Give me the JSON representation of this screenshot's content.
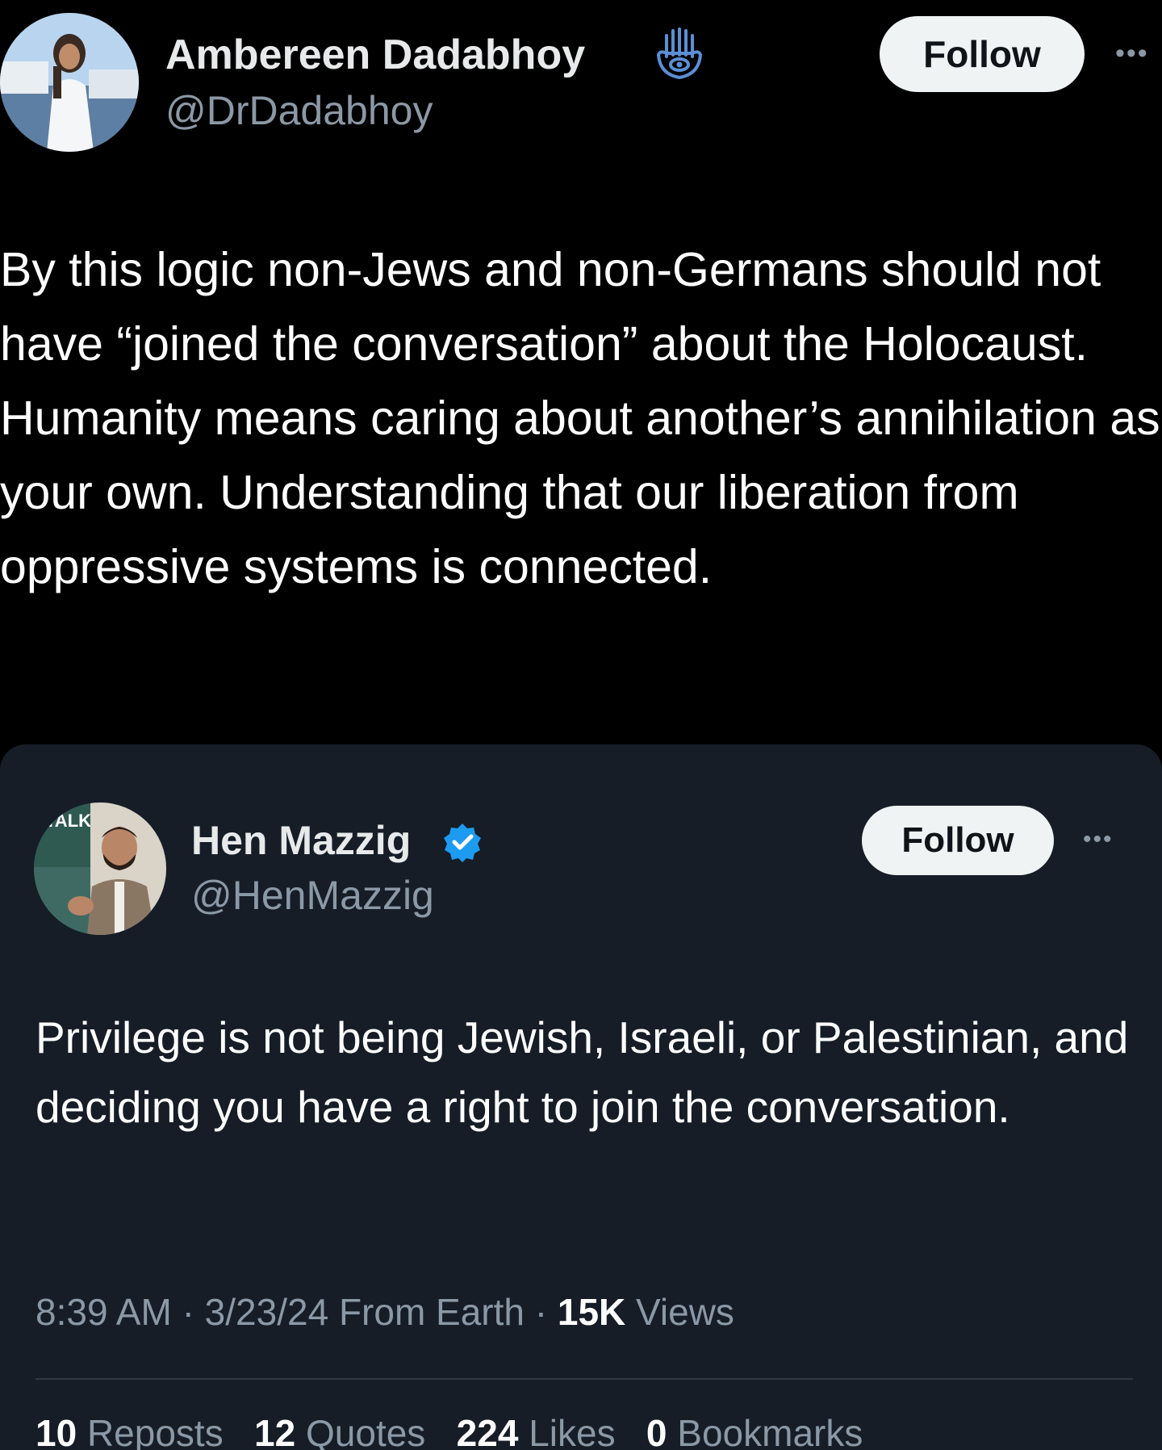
{
  "outer_tweet": {
    "author_name": "Ambereen Dadabhoy",
    "author_handle": "@DrDadabhoy",
    "follow_label": "Follow",
    "more_label": "•••",
    "badge_icon": "hamsa-icon",
    "text": "By this logic non-Jews and non-Germans should not have “joined the conversation” about the Holocaust. Humanity means caring about another’s annihilation as your own. Understanding that our liberation from oppressive systems is connected."
  },
  "quoted_tweet": {
    "author_name": "Hen Mazzig",
    "author_handle": "@HenMazzig",
    "follow_label": "Follow",
    "more_label": "•••",
    "badge_icon": "verified-icon",
    "avatar_sign_text": "TALK JUSTICE",
    "text": "Privilege is not being Jewish, Israeli, or Palestinian, and deciding you have a right to join the conversation.",
    "time": "8:39 AM",
    "date": "3/23/24",
    "location": "From Earth",
    "views_count": "15K",
    "views_label": "Views",
    "stats": {
      "reposts_count": "10",
      "reposts_label": "Reposts",
      "quotes_count": "12",
      "quotes_label": "Quotes",
      "likes_count": "224",
      "likes_label": "Likes",
      "bookmarks_count": "0",
      "bookmarks_label": "Bookmarks"
    }
  },
  "colors": {
    "background": "#000000",
    "card_background": "#161d27",
    "text_primary": "#e7e9ea",
    "text_secondary": "#8b98a5",
    "follow_button_bg": "#eff3f4",
    "verified_blue": "#1d9bf0",
    "hamsa_blue": "#5b8fd6"
  }
}
